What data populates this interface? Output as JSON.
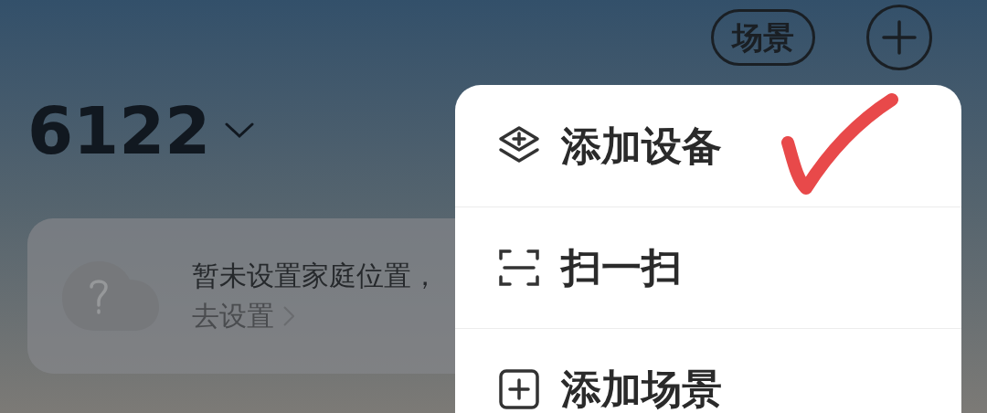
{
  "header": {
    "scene_button": "场景",
    "home_name": "6122"
  },
  "location_card": {
    "message": "暂未设置家庭位置，",
    "link": "去设置"
  },
  "menu": [
    {
      "kind": "add_device",
      "label": "添加设备"
    },
    {
      "kind": "scan",
      "label": "扫一扫"
    },
    {
      "kind": "add_scene",
      "label": "添加场景"
    }
  ]
}
